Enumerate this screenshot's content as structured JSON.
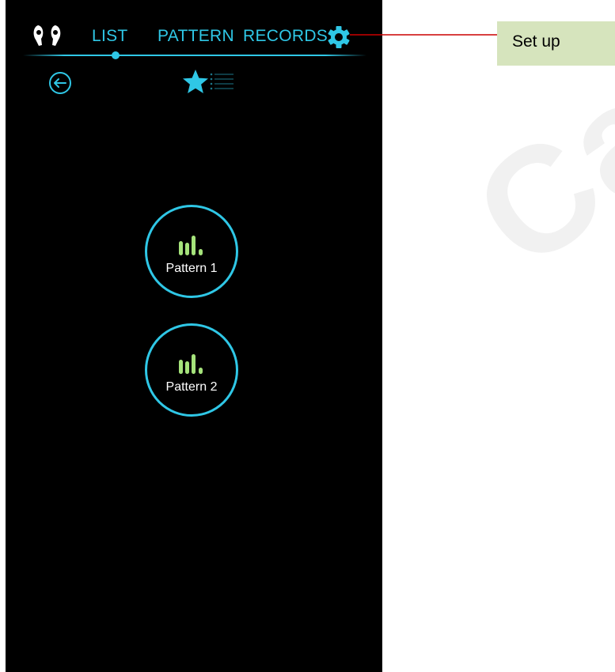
{
  "nav": {
    "list": "LIST",
    "pattern": "PATTERN",
    "records": "RECORDS",
    "active": "LIST"
  },
  "icons": {
    "devices": "earbuds-icon",
    "settings": "gear-icon",
    "back": "back-arrow-icon",
    "favorite": "star-icon",
    "list": "list-icon",
    "pattern": "equalizer-bars-icon"
  },
  "patterns": [
    {
      "label": "Pattern 1"
    },
    {
      "label": "Pattern 2"
    }
  ],
  "annotation": {
    "text": "Set up"
  },
  "watermark": "Cant",
  "colors": {
    "accent": "#2fc7e6",
    "background": "#000000",
    "bars": "#a5e37b",
    "annotation_bg": "#d6e4bd",
    "annotation_line": "#cc0000"
  }
}
